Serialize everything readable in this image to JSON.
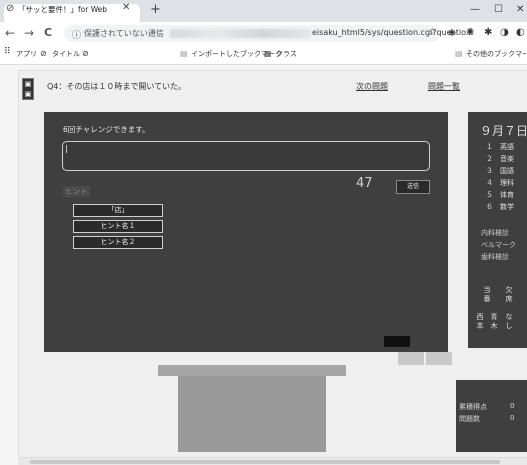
{
  "browser": {
    "tab_title": "「サッと要件！」for Web",
    "tab_close": "✕",
    "new_tab": "+",
    "window_min": "—",
    "window_max": "☐",
    "window_close": "✕",
    "nav_back": "←",
    "nav_forward": "→",
    "nav_reload": "C",
    "url_info_icon": "ⓘ",
    "url_security": "保護されていない通信",
    "url_path": "eisaku_html5/sys/question.cgi?questio...",
    "star": "☆",
    "bookmarks": {
      "apps": "アプリ",
      "bm1": "タイトル",
      "imported": "インポートしたブックマーク",
      "class": "クラス",
      "other": "その他のブックマーク"
    }
  },
  "page": {
    "question": "Q4：その店は１０時まで開いていた。",
    "next_link": "次の問題",
    "list_link": "問題一覧",
    "tries": "6回チャレンジできます。",
    "count": "47",
    "send_label": "送信",
    "hint_label": "ヒント",
    "hints": [
      "「店」",
      "ヒント名１",
      "ヒント名２"
    ]
  },
  "side": {
    "date": "９月７日",
    "schedule": [
      {
        "num": "１",
        "subject": "英語"
      },
      {
        "num": "２",
        "subject": "音楽"
      },
      {
        "num": "３",
        "subject": "国語"
      },
      {
        "num": "４",
        "subject": "理科"
      },
      {
        "num": "５",
        "subject": "体育"
      },
      {
        "num": "６",
        "subject": "数学"
      }
    ],
    "notes": [
      "内科検診",
      "ベルマーク",
      "歯科検診"
    ],
    "duty_1_head": "当番",
    "duty_1_val": "欠席",
    "duty_2_head": "西本",
    "duty_2_mid": "青木",
    "duty_2_val": "なし"
  },
  "score": {
    "label1": "累積得点",
    "value1": "0",
    "label2": "問題数",
    "value2": "0"
  }
}
